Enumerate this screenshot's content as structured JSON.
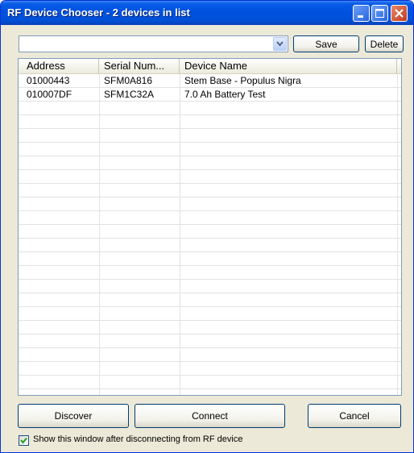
{
  "window": {
    "title": "RF Device Chooser - 2 devices in list"
  },
  "toolbar": {
    "combo_value": "",
    "save_label": "Save",
    "delete_label": "Delete"
  },
  "list": {
    "columns": [
      "Address",
      "Serial Num...",
      "Device Name"
    ],
    "rows": [
      {
        "address": "01000443",
        "serial": "SFM0A816",
        "name": "Stem Base - Populus Nigra"
      },
      {
        "address": "010007DF",
        "serial": "SFM1C32A",
        "name": "7.0 Ah Battery Test"
      }
    ]
  },
  "actions": {
    "discover_label": "Discover",
    "connect_label": "Connect",
    "cancel_label": "Cancel"
  },
  "options": {
    "show_after_disconnect_label": "Show this window after disconnecting from RF device",
    "show_after_disconnect_checked": true
  },
  "icons": {
    "minimize": "minimize-icon",
    "maximize": "maximize-icon",
    "close": "close-icon",
    "dropdown": "chevron-down-icon",
    "check": "checkmark-icon"
  },
  "colors": {
    "titlebar": "#0053e1",
    "window_bg": "#ece9d8",
    "close_button": "#c2391a",
    "check_green": "#21a121"
  }
}
